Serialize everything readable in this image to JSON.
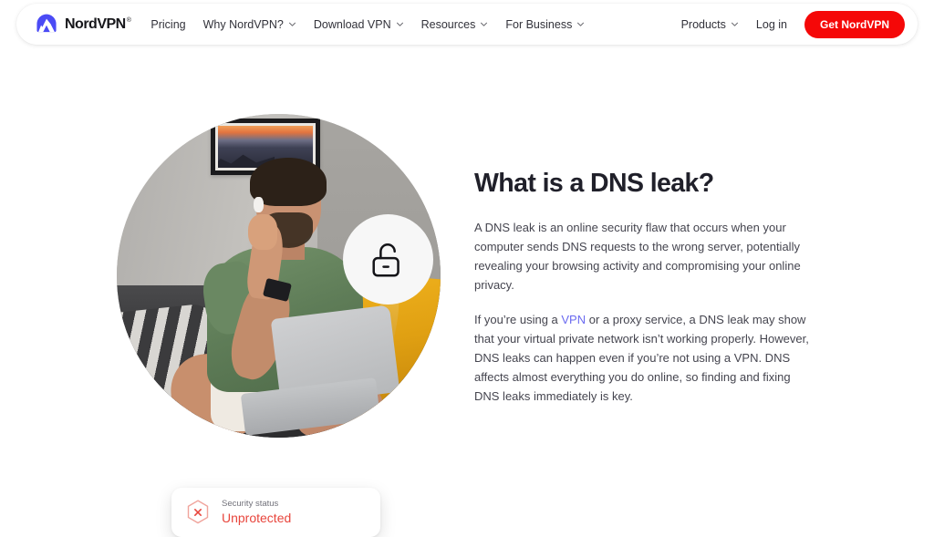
{
  "brand": {
    "name": "NordVPN",
    "trademark": "®",
    "logo_icon": "nordvpn-mountain-logo"
  },
  "nav": {
    "left_items": [
      {
        "label": "Pricing",
        "has_chevron": false
      },
      {
        "label": "Why NordVPN?",
        "has_chevron": true
      },
      {
        "label": "Download VPN",
        "has_chevron": true
      },
      {
        "label": "Resources",
        "has_chevron": true
      },
      {
        "label": "For Business",
        "has_chevron": true
      }
    ],
    "right_items": [
      {
        "label": "Products",
        "has_chevron": true
      },
      {
        "label": "Log in",
        "has_chevron": false
      }
    ],
    "cta_label": "Get NordVPN",
    "cta_color": "#f50808"
  },
  "hero": {
    "badge_icon": "unlock-icon",
    "photo_alt": "Man in green t-shirt sitting on a couch looking at a laptop",
    "status_card": {
      "icon": "hexagon-x-icon",
      "label": "Security status",
      "value": "Unprotected",
      "value_color": "#e8453c"
    }
  },
  "main": {
    "title": "What is a DNS leak?",
    "paragraph_1": "A DNS leak is an online security flaw that occurs when your computer sends DNS requests to the wrong server, potentially revealing your browsing activity and compromising your online privacy.",
    "paragraph_2_before_link": "If you’re using a ",
    "paragraph_2_link": "VPN",
    "paragraph_2_after_link": " or a proxy service, a DNS leak may show that your virtual private network isn’t working properly. However, DNS leaks can happen even if you’re not using a VPN. DNS affects almost everything you do online, so finding and fixing DNS leaks immediately is key.",
    "link_color": "#6a6af0"
  }
}
